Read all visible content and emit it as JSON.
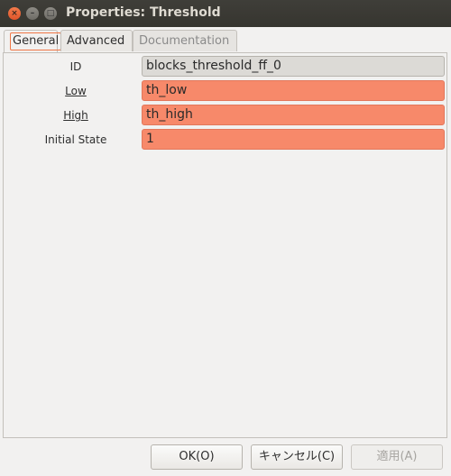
{
  "window": {
    "title": "Properties: Threshold",
    "close_glyph": "×",
    "min_glyph": "–",
    "max_glyph": "□"
  },
  "tabs": [
    {
      "label": "General",
      "active": true
    },
    {
      "label": "Advanced",
      "active": false
    },
    {
      "label": "Documentation",
      "active": false
    }
  ],
  "params": [
    {
      "label": "ID",
      "value": "blocks_threshold_ff_0",
      "state": "readonly"
    },
    {
      "label": "Low",
      "value": "th_low",
      "state": "error"
    },
    {
      "label": "High",
      "value": "th_high",
      "state": "error"
    },
    {
      "label": "Initial State",
      "value": "1",
      "state": "error"
    }
  ],
  "buttons": {
    "ok": "OK(O)",
    "cancel": "キャンセル(C)",
    "apply": "適用(A)"
  },
  "colors": {
    "error_field": "#f7896a",
    "readonly_field": "#dcdad6",
    "titlebar": "#3c3b37",
    "accent": "#f07746"
  }
}
